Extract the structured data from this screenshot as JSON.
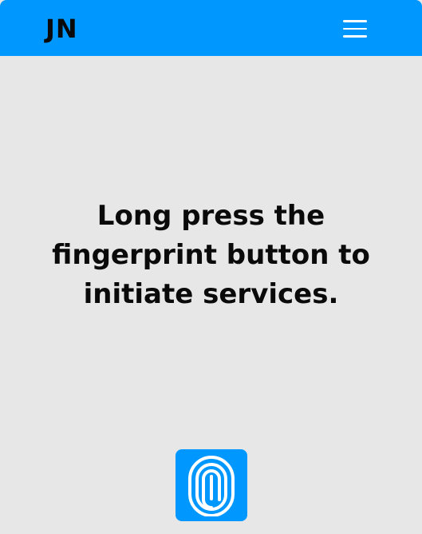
{
  "header": {
    "logo_text": "JN",
    "menu_icon": "hamburger-menu-icon"
  },
  "main": {
    "message": "Long press the fingerprint button to initiate services."
  },
  "fingerprint_button": {
    "icon": "fingerprint-icon"
  },
  "colors": {
    "accent": "#0098ff",
    "background": "#e7e7e7",
    "text": "#0a0a0a",
    "icon": "#ffffff"
  }
}
